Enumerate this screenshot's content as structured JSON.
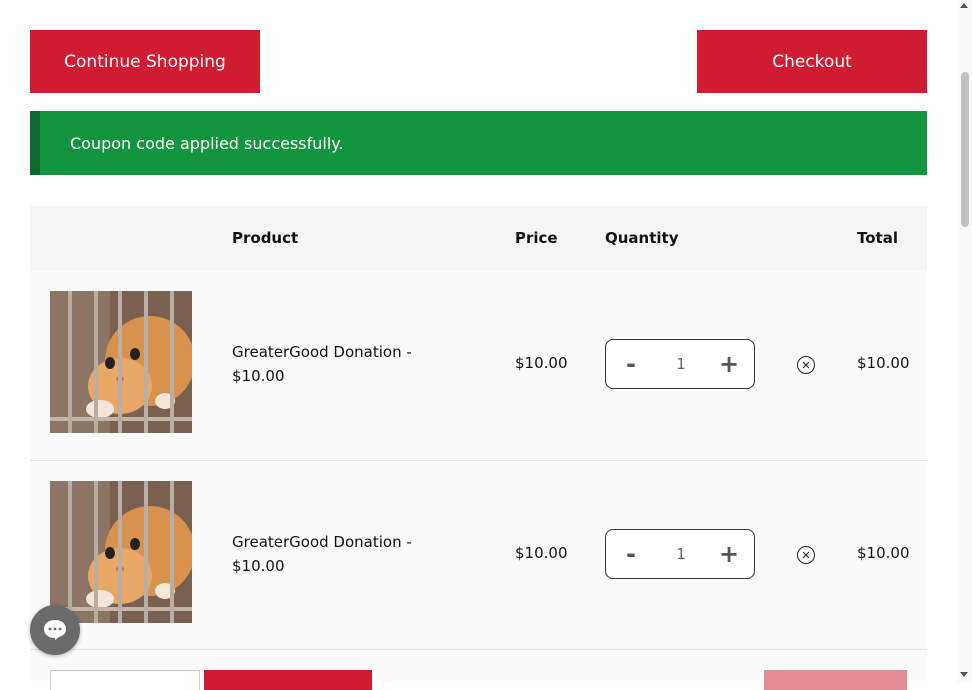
{
  "actions": {
    "continue_label": "Continue Shopping",
    "checkout_label": "Checkout"
  },
  "notice": {
    "message": "Coupon code applied successfully.",
    "color": "#13953f"
  },
  "table": {
    "headers": {
      "product": "Product",
      "price": "Price",
      "quantity": "Quantity",
      "total": "Total"
    },
    "rows": [
      {
        "name": "GreaterGood Donation - $10.00",
        "price": "$10.00",
        "quantity": "1",
        "total": "$10.00"
      },
      {
        "name": "GreaterGood Donation - $10.00",
        "price": "$10.00",
        "quantity": "1",
        "total": "$10.00"
      }
    ]
  },
  "qty_controls": {
    "minus": "-",
    "plus": "+",
    "remove_icon": "close-circle-icon"
  },
  "brand_color": "#cf1c32"
}
